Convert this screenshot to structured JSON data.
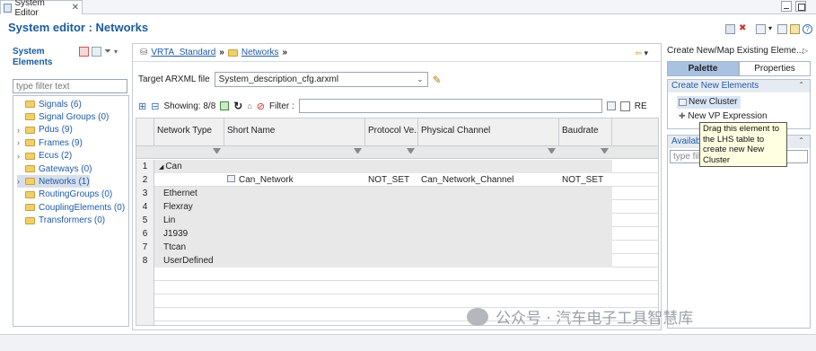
{
  "tab": {
    "title": "System Editor",
    "close": "✕"
  },
  "header": {
    "title": "System editor : Networks"
  },
  "left": {
    "title": "System Elements",
    "filter_placeholder": "type filter text",
    "items": [
      {
        "label": "Signals (6)",
        "expandable": false
      },
      {
        "label": "Signal Groups (0)",
        "expandable": false
      },
      {
        "label": "Pdus (9)",
        "expandable": true
      },
      {
        "label": "Frames (9)",
        "expandable": true
      },
      {
        "label": "Ecus (2)",
        "expandable": true
      },
      {
        "label": "Gateways (0)",
        "expandable": false
      },
      {
        "label": "Networks (1)",
        "expandable": true,
        "selected": true
      },
      {
        "label": "RoutingGroups (0)",
        "expandable": false
      },
      {
        "label": "CouplingElements (0)",
        "expandable": false
      },
      {
        "label": "Transformers (0)",
        "expandable": false
      }
    ]
  },
  "breadcrumb": {
    "items": [
      "VRTA_Standard",
      "Networks"
    ]
  },
  "arxml": {
    "label": "Target ARXML file",
    "value": "System_description_cfg.arxml"
  },
  "table_toolbar": {
    "showing": "Showing: 8/8",
    "filter_label": "Filter :",
    "re_label": "RE"
  },
  "table": {
    "headers": [
      "Network Type",
      "Short Name",
      "Protocol Ve...",
      "Physical Channel",
      "Baudrate"
    ],
    "rows": [
      {
        "num": "1",
        "type": "Can",
        "short": "",
        "protocol": "",
        "channel": "",
        "baud": "",
        "expanded": true
      },
      {
        "num": "2",
        "type": "",
        "short": "Can_Network",
        "protocol": "NOT_SET",
        "channel": "Can_Network_Channel",
        "baud": "NOT_SET"
      },
      {
        "num": "3",
        "type": "Ethernet",
        "short": "",
        "protocol": "",
        "channel": "",
        "baud": ""
      },
      {
        "num": "4",
        "type": "Flexray",
        "short": "",
        "protocol": "",
        "channel": "",
        "baud": ""
      },
      {
        "num": "5",
        "type": "Lin",
        "short": "",
        "protocol": "",
        "channel": "",
        "baud": ""
      },
      {
        "num": "6",
        "type": "J1939",
        "short": "",
        "protocol": "",
        "channel": "",
        "baud": ""
      },
      {
        "num": "7",
        "type": "Ttcan",
        "short": "",
        "protocol": "",
        "channel": "",
        "baud": ""
      },
      {
        "num": "8",
        "type": "UserDefined",
        "short": "",
        "protocol": "",
        "channel": "",
        "baud": ""
      }
    ]
  },
  "right": {
    "title": "Create New/Map Existing Eleme...",
    "tabs": [
      "Palette",
      "Properties"
    ],
    "section1": "Create New Elements",
    "items": [
      "New Cluster",
      "New VP Expression"
    ],
    "section2": "Availab",
    "filter_placeholder": "type filt",
    "tooltip": "Drag this element to the LHS table to create new New Cluster"
  },
  "watermark": "公众号 · 汽车电子工具智慧库"
}
